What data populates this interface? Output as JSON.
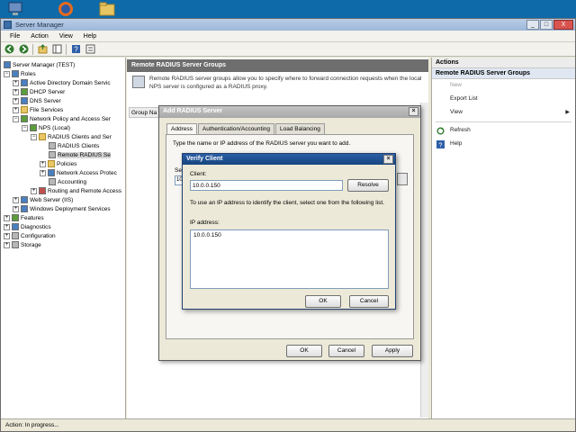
{
  "desktop": {
    "icons": [
      "computer-icon",
      "firefox-icon",
      "folder-icon"
    ]
  },
  "window": {
    "title": "Server Manager",
    "controls": [
      "_",
      "□",
      "X"
    ]
  },
  "menu": {
    "items": [
      "File",
      "Action",
      "View",
      "Help"
    ]
  },
  "toolbar": {
    "icons": [
      "back-icon",
      "forward-icon",
      "up-icon",
      "console-tree-icon",
      "help-icon",
      "properties-icon"
    ]
  },
  "tree": {
    "items": [
      {
        "label": "Server Manager (TEST)",
        "expander": "",
        "icon": "server-icon"
      },
      {
        "label": "Roles",
        "expander": "−",
        "icon": "roles-icon"
      },
      {
        "label": "Active Directory Domain Servic",
        "expander": "+",
        "icon": "ad-icon"
      },
      {
        "label": "DHCP Server",
        "expander": "+",
        "icon": "dhcp-icon"
      },
      {
        "label": "DNS Server",
        "expander": "+",
        "icon": "dns-icon"
      },
      {
        "label": "File Services",
        "expander": "+",
        "icon": "file-services-icon"
      },
      {
        "label": "Network Policy and Access Ser",
        "expander": "−",
        "icon": "npas-icon"
      },
      {
        "label": "NPS (Local)",
        "expander": "−",
        "icon": "nps-icon"
      },
      {
        "label": "RADIUS Clients and Ser",
        "expander": "−",
        "icon": "folder-icon"
      },
      {
        "label": "RADIUS Clients",
        "expander": "",
        "icon": "radius-clients-icon"
      },
      {
        "label": "Remote RADIUS Se",
        "expander": "",
        "icon": "radius-servers-icon"
      },
      {
        "label": "Policies",
        "expander": "+",
        "icon": "folder-icon"
      },
      {
        "label": "Network Access Protec",
        "expander": "+",
        "icon": "nap-icon"
      },
      {
        "label": "Accounting",
        "expander": "",
        "icon": "accounting-icon"
      },
      {
        "label": "Routing and Remote Access",
        "expander": "+",
        "icon": "routing-icon"
      },
      {
        "label": "Web Server (IIS)",
        "expander": "+",
        "icon": "iis-icon"
      },
      {
        "label": "Windows Deployment Services",
        "expander": "+",
        "icon": "wds-icon"
      },
      {
        "label": "Features",
        "expander": "+",
        "icon": "features-icon"
      },
      {
        "label": "Diagnostics",
        "expander": "+",
        "icon": "diagnostics-icon"
      },
      {
        "label": "Configuration",
        "expander": "+",
        "icon": "configuration-icon"
      },
      {
        "label": "Storage",
        "expander": "+",
        "icon": "storage-icon"
      }
    ]
  },
  "center": {
    "header": "Remote RADIUS Server Groups",
    "description": "Remote RADIUS server groups allow you to specify where to forward connection requests when the local NPS server is configured as a RADIUS proxy.",
    "column": "Group Na"
  },
  "actions": {
    "header": "Actions",
    "section": "Remote RADIUS Server Groups",
    "items": [
      {
        "label": "New",
        "enabled": false,
        "icon": "",
        "submenu": false
      },
      {
        "label": "Export List",
        "enabled": true,
        "icon": "",
        "submenu": false
      },
      {
        "label": "View",
        "enabled": true,
        "icon": "",
        "submenu": true
      },
      {
        "label": "Refresh",
        "enabled": true,
        "icon": "refresh-icon",
        "submenu": false
      },
      {
        "label": "Help",
        "enabled": true,
        "icon": "help-icon",
        "submenu": false
      }
    ]
  },
  "status": {
    "text": "Action:  In progress..."
  },
  "add_server_dialog": {
    "title": "Add RADIUS Server",
    "tabs": [
      "Address",
      "Authentication/Accounting",
      "Load Balancing"
    ],
    "active_tab": "Address",
    "prompt": "Type the name or IP address of the RADIUS server you want to add.",
    "server_label": "Ser",
    "server_value": "10",
    "buttons": {
      "ok": "OK",
      "cancel": "Cancel",
      "apply": "Apply"
    }
  },
  "verify_client_dialog": {
    "title": "Verify Client",
    "client_label": "Client:",
    "client_value": "10.0.0.150",
    "resolve_label": "Resolve",
    "hint": "To use an IP address to identify the client, select one from the following list.",
    "ip_label": "IP address:",
    "ip_list": [
      "10.0.0.150"
    ],
    "buttons": {
      "ok": "OK",
      "cancel": "Cancel"
    }
  }
}
